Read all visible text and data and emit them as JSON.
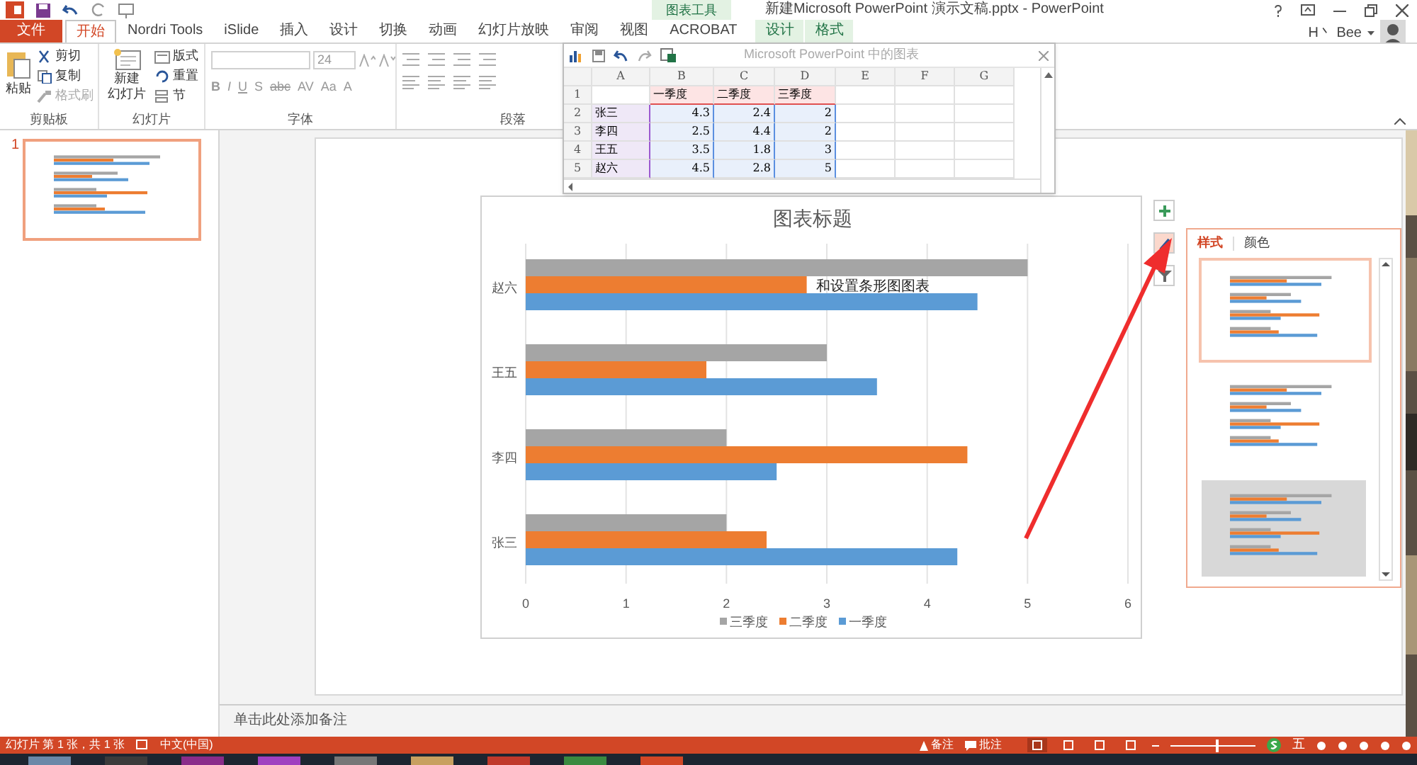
{
  "window": {
    "title": "新建Microsoft PowerPoint 演示文稿.pptx - PowerPoint",
    "context_label": "图表工具",
    "user": "H丶 Bee"
  },
  "tabs": [
    {
      "label": "文件",
      "kind": "file",
      "selected": false
    },
    {
      "label": "开始",
      "kind": "normal",
      "selected": true
    },
    {
      "label": "Nordri Tools",
      "kind": "normal",
      "selected": false
    },
    {
      "label": "iSlide",
      "kind": "normal",
      "selected": false
    },
    {
      "label": "插入",
      "kind": "normal",
      "selected": false
    },
    {
      "label": "设计",
      "kind": "normal",
      "selected": false
    },
    {
      "label": "切换",
      "kind": "normal",
      "selected": false
    },
    {
      "label": "动画",
      "kind": "normal",
      "selected": false
    },
    {
      "label": "幻灯片放映",
      "kind": "normal",
      "selected": false
    },
    {
      "label": "审阅",
      "kind": "normal",
      "selected": false
    },
    {
      "label": "视图",
      "kind": "normal",
      "selected": false
    },
    {
      "label": "ACROBAT",
      "kind": "normal",
      "selected": false
    },
    {
      "label": "设计",
      "kind": "context",
      "selected": false
    },
    {
      "label": "格式",
      "kind": "context",
      "selected": false
    }
  ],
  "ribbon": {
    "clipboard": {
      "label": "剪贴板",
      "paste": "粘贴",
      "items": [
        {
          "label": "剪切",
          "disabled": false
        },
        {
          "label": "复制",
          "disabled": false
        },
        {
          "label": "格式刷",
          "disabled": true
        }
      ]
    },
    "slides": {
      "label": "幻灯片",
      "new_slide": [
        "新建",
        "幻灯片"
      ],
      "items": [
        "版式",
        "重置",
        "节"
      ]
    },
    "font": {
      "label": "字体",
      "size": "24",
      "buttons": [
        "B",
        "I",
        "U",
        "S",
        "abc",
        "AV",
        "Aa",
        "A"
      ]
    },
    "paragraph": {
      "label": "段落"
    }
  },
  "thumbnails": [
    {
      "number": "1",
      "selected": true
    }
  ],
  "sheet": {
    "title": "Microsoft PowerPoint 中的图表",
    "columns": [
      "A",
      "B",
      "C",
      "D",
      "E",
      "F",
      "G"
    ],
    "header_row": {
      "number": "1",
      "labels": [
        "一季度",
        "二季度",
        "三季度"
      ]
    },
    "rows": [
      {
        "number": "2",
        "label": "张三",
        "values": [
          "4.3",
          "2.4",
          "2"
        ]
      },
      {
        "number": "3",
        "label": "李四",
        "values": [
          "2.5",
          "4.4",
          "2"
        ]
      },
      {
        "number": "4",
        "label": "王五",
        "values": [
          "3.5",
          "1.8",
          "3"
        ]
      },
      {
        "number": "5",
        "label": "赵六",
        "values": [
          "4.5",
          "2.8",
          "5"
        ]
      }
    ]
  },
  "slide": {
    "covered_text": "和设置条形图图表",
    "chart": {
      "chart_data": {
        "type": "bar",
        "orientation": "horizontal",
        "title": "图表标题",
        "categories": [
          "赵六",
          "王五",
          "李四",
          "张三"
        ],
        "series": [
          {
            "name": "一季度",
            "color": "#5b9bd5",
            "values": [
              4.5,
              3.5,
              2.5,
              4.3
            ]
          },
          {
            "name": "二季度",
            "color": "#ed7d31",
            "values": [
              2.8,
              1.8,
              4.4,
              2.4
            ]
          },
          {
            "name": "三季度",
            "color": "#a5a5a5",
            "values": [
              5,
              3,
              2,
              2
            ]
          }
        ],
        "xlim": [
          0,
          6
        ],
        "xticks": [
          0,
          1,
          2,
          3,
          4,
          5,
          6
        ],
        "grid": true,
        "legend": true
      }
    }
  },
  "chart_buttons": [
    {
      "kind": "plus",
      "selected": false
    },
    {
      "kind": "brush",
      "selected": true
    },
    {
      "kind": "filter",
      "selected": false
    }
  ],
  "style_panel": {
    "tabs": [
      {
        "label": "样式",
        "selected": true
      },
      {
        "label": "颜色",
        "selected": false
      }
    ],
    "styles": [
      {
        "selected": true
      },
      {
        "selected": false
      },
      {
        "selected": false
      }
    ]
  },
  "notes": {
    "placeholder": "单击此处添加备注"
  },
  "status_bar": {
    "slide_info": "幻灯片 第 1 张，共 1 张",
    "language": "中文(中国)",
    "notes": "备注",
    "comments": "批注",
    "zoom": {
      "level": 0.55
    },
    "ime": "五"
  }
}
